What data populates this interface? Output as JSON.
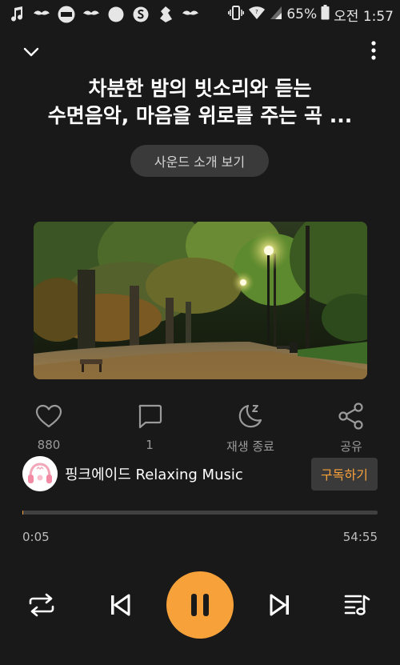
{
  "status_bar": {
    "battery_percent": "65%",
    "time": "오전 1:57",
    "notification_icons": [
      "music-note-icon",
      "mustache-icon",
      "lock-app-icon",
      "mustache-icon",
      "circle-icon",
      "s-app-icon",
      "glyph-app-icon",
      "mustache-icon"
    ]
  },
  "track": {
    "title_line1": "차분한 밤의 빗소리와 듣는",
    "title_line2": "수면음악, 마음을 위로를 주는 곡 ...",
    "intro_button": "사운드 소개 보기"
  },
  "actions": {
    "like_count": "880",
    "comment_count": "1",
    "sleep_timer_label": "재생 종료",
    "share_label": "공유"
  },
  "channel": {
    "name": "핑크에이드 Relaxing Music",
    "subscribe_label": "구독하기"
  },
  "playback": {
    "current_time": "0:05",
    "total_time": "54:55",
    "progress_fraction": 0.002,
    "state": "playing"
  },
  "colors": {
    "accent": "#f7a13a",
    "background": "#191919"
  }
}
